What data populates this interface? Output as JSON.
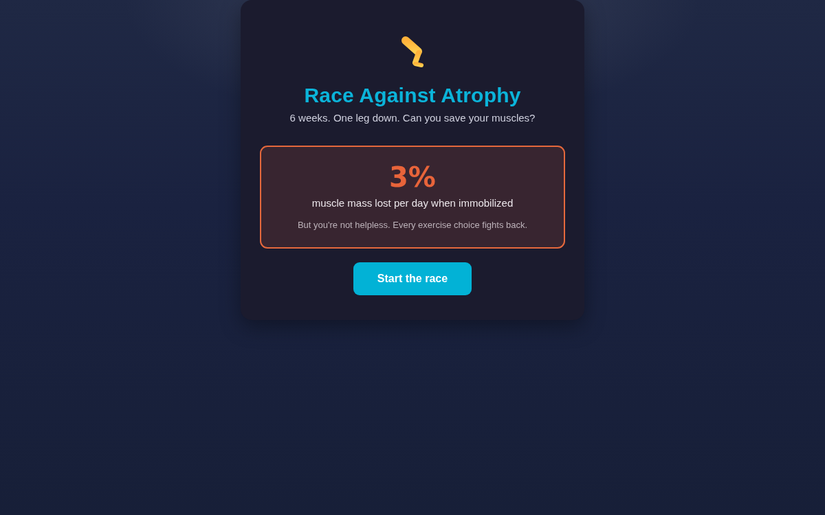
{
  "hero": {
    "title": "Race Against Atrophy",
    "subtitle": "6 weeks. One leg down. Can you save your muscles?"
  },
  "stat": {
    "value": "3%",
    "label": "muscle mass lost per day when immobilized",
    "note": "But you're not helpless. Every exercise choice fights back."
  },
  "start_button": {
    "label": "Start the race"
  }
}
